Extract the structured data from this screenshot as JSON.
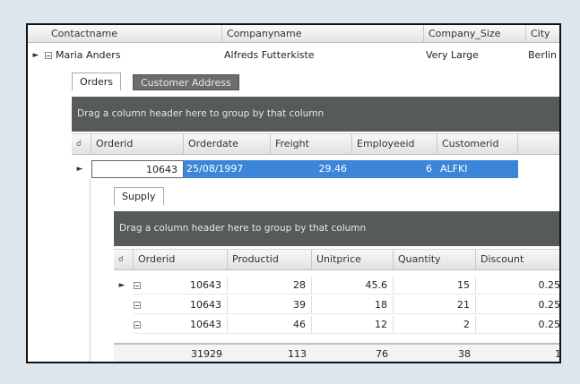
{
  "master": {
    "columns": [
      "Contactname",
      "Companyname",
      "Company_Size",
      "City"
    ],
    "row": {
      "contactname": "Maria Anders",
      "companyname": "Alfreds Futterkiste",
      "company_size": "Very Large",
      "city": "Berlin"
    }
  },
  "tabs": {
    "orders": "Orders",
    "customer_address": "Customer Address"
  },
  "orders": {
    "group_hint": "Drag a column header here to group by that column",
    "columns": [
      "Orderid",
      "Orderdate",
      "Freight",
      "Employeeid",
      "Customerid"
    ],
    "row": {
      "orderid": "10643",
      "orderdate": "25/08/1997",
      "freight": "29.46",
      "employeeid": "6",
      "customerid": "ALFKI"
    }
  },
  "supply_tab": "Supply",
  "supply": {
    "group_hint": "Drag a column header here to group by that column",
    "columns": [
      "Orderid",
      "Productid",
      "Unitprice",
      "Quantity",
      "Discount"
    ],
    "rows": [
      {
        "orderid": "10643",
        "productid": "28",
        "unitprice": "45.6",
        "quantity": "15",
        "discount": "0.25"
      },
      {
        "orderid": "10643",
        "productid": "39",
        "unitprice": "18",
        "quantity": "21",
        "discount": "0.25"
      },
      {
        "orderid": "10643",
        "productid": "46",
        "unitprice": "12",
        "quantity": "2",
        "discount": "0.25"
      }
    ],
    "totals": {
      "orderid": "31929",
      "productid": "113",
      "unitprice": "76",
      "quantity": "38",
      "discount": "1"
    }
  },
  "colors": {
    "selection": "#3b86d8",
    "group_panel": "#575a5b",
    "inactive_tab": "#6c6c6c"
  }
}
